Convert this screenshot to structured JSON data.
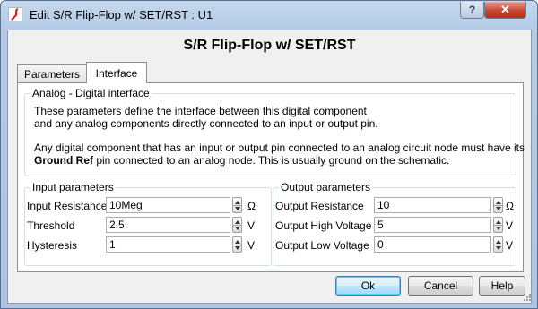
{
  "window": {
    "title": "Edit S/R Flip-Flop w/ SET/RST : U1",
    "help_button": "?",
    "close_button": "✕"
  },
  "heading": "S/R Flip-Flop w/ SET/RST",
  "tabs": [
    {
      "label": "Parameters",
      "selected": false
    },
    {
      "label": "Interface",
      "selected": true
    }
  ],
  "analog_group": {
    "title": "Analog - Digital interface",
    "line1": "These parameters define the interface between this digital component",
    "line2": "and any analog components directly connected to an input or output pin.",
    "line3": "Any digital component that has an input or output pin connected to an analog circuit node must have its",
    "line4_bold": "Ground Ref",
    "line4_rest": " pin connected to an analog node. This is usually ground on the schematic."
  },
  "input_params": {
    "title": "Input parameters",
    "rows": [
      {
        "label": "Input Resistance",
        "value": "10Meg",
        "unit": "Ω"
      },
      {
        "label": "Threshold",
        "value": "2.5",
        "unit": "V"
      },
      {
        "label": "Hysteresis",
        "value": "1",
        "unit": "V"
      }
    ]
  },
  "output_params": {
    "title": "Output parameters",
    "rows": [
      {
        "label": "Output Resistance",
        "value": "10",
        "unit": "Ω"
      },
      {
        "label": "Output High Voltage",
        "value": "5",
        "unit": "V"
      },
      {
        "label": "Output Low Voltage",
        "value": "0",
        "unit": "V"
      }
    ]
  },
  "buttons": {
    "ok": "Ok",
    "cancel": "Cancel",
    "help": "Help"
  },
  "colors": {
    "title_bar": "#b6cce6",
    "close_button": "#c8452e",
    "dialog_background": "#f0f0f0"
  }
}
